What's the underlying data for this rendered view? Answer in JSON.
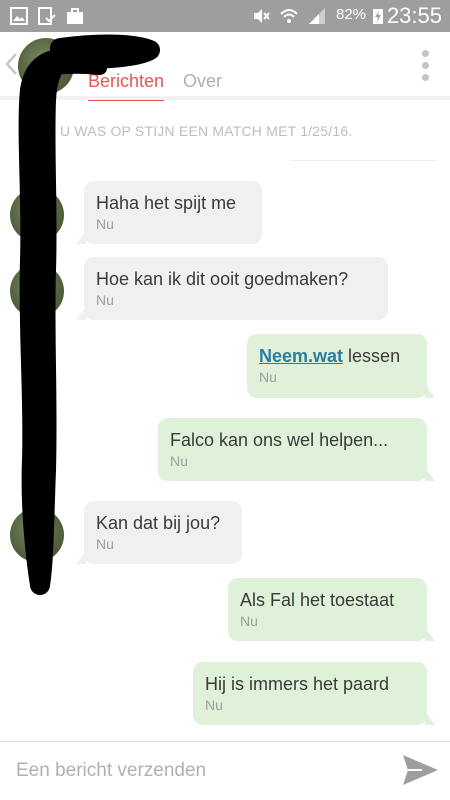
{
  "status_bar": {
    "battery_percent": "82%",
    "time": "23:55",
    "icons": [
      "gallery-icon",
      "download-done-icon",
      "briefcase-icon",
      "mute-icon",
      "wifi-icon",
      "signal-icon",
      "battery-charging-icon"
    ]
  },
  "header": {
    "contact_name": "",
    "tabs": [
      {
        "label": "Berichten",
        "active": true
      },
      {
        "label": "Over",
        "active": false
      }
    ],
    "accent_color": "#e85556"
  },
  "match_note": "U WAS OP STIJN EEN MATCH MET 1/25/16.",
  "messages": [
    {
      "direction": "received",
      "text": "Haha het spijt me",
      "time": "Nu"
    },
    {
      "direction": "received",
      "text": "Hoe kan ik dit ooit goedmaken?",
      "time": "Nu"
    },
    {
      "direction": "sent",
      "link": "Neem.wat",
      "text": " lessen",
      "time": "Nu"
    },
    {
      "direction": "sent",
      "text": "Falco kan ons wel helpen...",
      "time": "Nu"
    },
    {
      "direction": "received",
      "text": "Kan dat bij jou?",
      "time": "Nu"
    },
    {
      "direction": "sent",
      "text": "Als Fal het toestaat",
      "time": "Nu"
    },
    {
      "direction": "sent",
      "text": "Hij is immers het paard",
      "time": "Nu"
    }
  ],
  "composer": {
    "placeholder": "Een bericht verzenden",
    "value": ""
  },
  "colors": {
    "received_bubble": "#f0f0f0",
    "sent_bubble": "#dff1d8",
    "link": "#2c7da0"
  }
}
